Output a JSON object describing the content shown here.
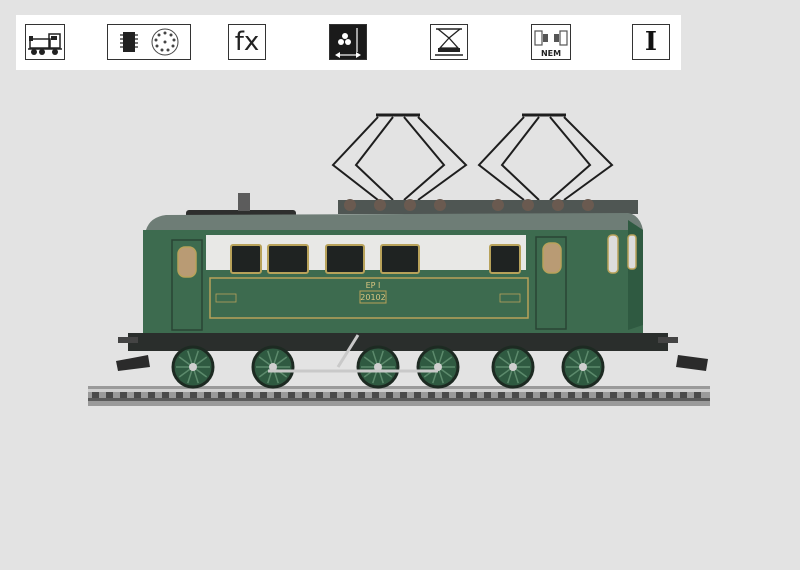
{
  "toolbar": {
    "icons": [
      {
        "name": "steam-locomotive-icon"
      },
      {
        "name": "digital-decoder-icon"
      },
      {
        "name": "sound-functions-icon",
        "label": "fx"
      },
      {
        "name": "headlight-icon"
      },
      {
        "name": "pantograph-icon"
      },
      {
        "name": "nem-coupler-icon",
        "label": "NEM"
      },
      {
        "name": "epoch-icon",
        "label": "I"
      }
    ]
  },
  "locomotive": {
    "class_label": "EP I",
    "road_number": "20102",
    "colors": {
      "body": "#3d6b4f",
      "window_band": "#e8e8e6",
      "roof": "#6e7d76",
      "trim": "#b8a25a",
      "frame": "#2a2e2c"
    }
  }
}
